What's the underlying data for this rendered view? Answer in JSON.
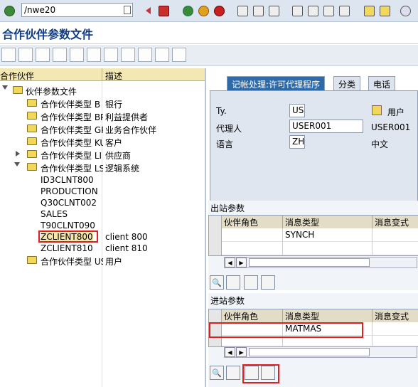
{
  "command": {
    "value": "/nwe20"
  },
  "window": {
    "title": "合作伙伴参数文件"
  },
  "tree": {
    "headers": {
      "name": "合作伙伴",
      "desc": "描述"
    },
    "rows": [
      {
        "name": "伙伴参数文件",
        "desc": ""
      },
      {
        "name": "合作伙伴类型 B",
        "desc": "银行"
      },
      {
        "name": "合作伙伴类型 BP",
        "desc": "利益提供者"
      },
      {
        "name": "合作伙伴类型 GP",
        "desc": "业务合作伙伴"
      },
      {
        "name": "合作伙伴类型 KU",
        "desc": "客户"
      },
      {
        "name": "合作伙伴类型 LI",
        "desc": "供应商"
      },
      {
        "name": "合作伙伴类型 LS",
        "desc": "逻辑系统"
      },
      {
        "name": "ID3CLNT800",
        "desc": ""
      },
      {
        "name": "PRODUCTION",
        "desc": ""
      },
      {
        "name": "Q30CLNT002",
        "desc": ""
      },
      {
        "name": "SALES",
        "desc": ""
      },
      {
        "name": "T90CLNT090",
        "desc": ""
      },
      {
        "name": "ZCLIENT800",
        "desc": "client 800"
      },
      {
        "name": "ZCLIENT810",
        "desc": "client 810"
      },
      {
        "name": "合作伙伴类型 US",
        "desc": "用户"
      }
    ]
  },
  "tabs": [
    "记帐处理:许可代理程序",
    "分类",
    "电话"
  ],
  "form": {
    "ty_label": "Ty.",
    "ty_value": "US",
    "ty_desc": "用户",
    "agent_label": "代理人",
    "agent_value": "USER001",
    "agent_desc": "USER001",
    "lang_label": "语言",
    "lang_value": "ZH",
    "lang_desc": "中文"
  },
  "outbound": {
    "title": "出站参数",
    "columns": [
      "伙伴角色",
      "消息类型",
      "消息变式"
    ],
    "rows": [
      {
        "role": "",
        "msgtype": "SYNCH",
        "variant": ""
      }
    ]
  },
  "inbound": {
    "title": "进站参数",
    "columns": [
      "伙伴角色",
      "消息类型",
      "消息变式"
    ],
    "rows": [
      {
        "role": "",
        "msgtype": "MATMAS",
        "variant": ""
      }
    ]
  },
  "icons": {
    "system": [
      "check-icon",
      "save-icon",
      "back-icon",
      "exit-icon",
      "cancel-icon",
      "print-icon",
      "find-icon",
      "find-next-icon",
      "first-page-icon",
      "prev-page-icon",
      "next-page-icon",
      "last-page-icon",
      "create-session-icon",
      "help-icon"
    ],
    "app": [
      "create-icon",
      "change-icon",
      "display-icon",
      "copy-icon",
      "delete-icon",
      "check-icon",
      "other-icon",
      "hierarchy-icon",
      "print-icon",
      "expand-icon",
      "collapse-icon"
    ]
  }
}
